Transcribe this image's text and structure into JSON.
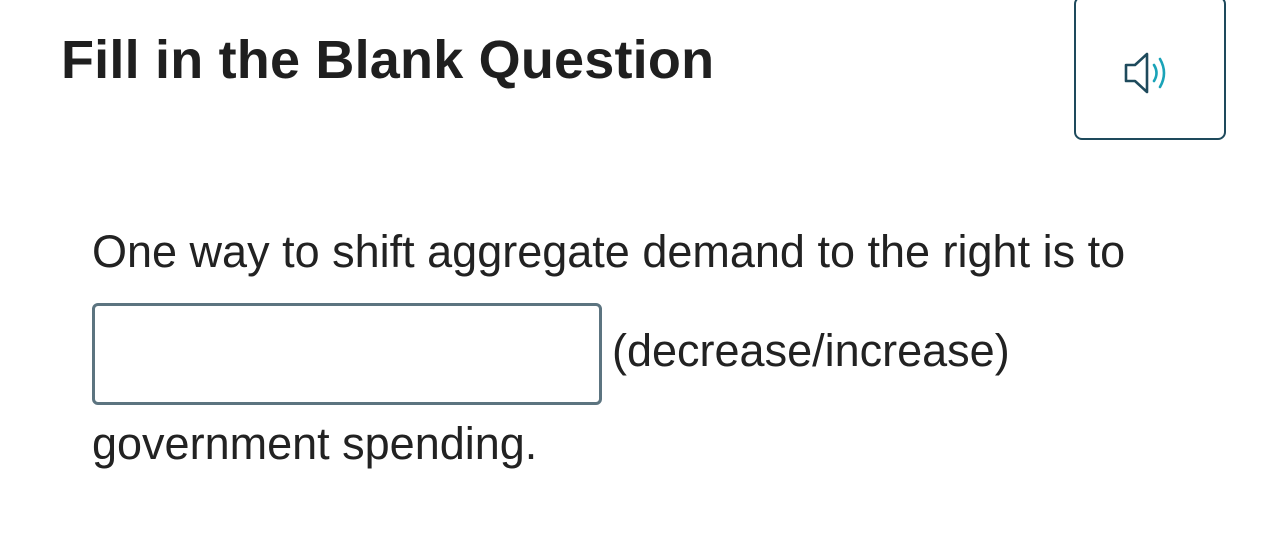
{
  "header": {
    "title": "Fill in the Blank Question",
    "audio_icon": "speaker-icon"
  },
  "question": {
    "text_before": "One way to shift aggregate demand to the right is to",
    "blank": {
      "value": "",
      "placeholder": ""
    },
    "hint": "(decrease/increase)",
    "text_after": "government spending."
  },
  "colors": {
    "button_border": "#1e4a5c",
    "speaker_outline": "#1e4a5c",
    "speaker_waves": "#1aa3b8",
    "input_border": "#5c7480"
  }
}
